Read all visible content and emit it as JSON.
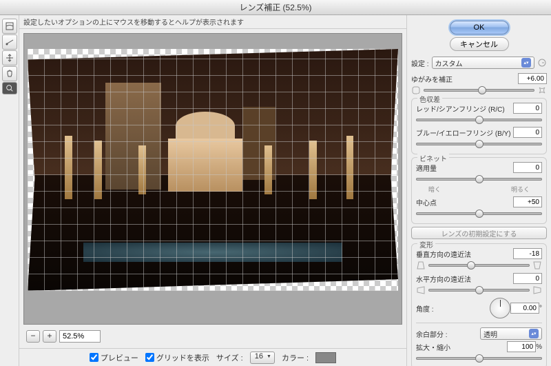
{
  "title": "レンズ補正 (52.5%)",
  "hint": "設定したいオプションの上にマウスを移動するとヘルプが表示されます",
  "zoom": {
    "value": "52.5%"
  },
  "bottom": {
    "preview": "プレビュー",
    "grid": "グリッドを表示",
    "size_label": "サイズ :",
    "size_value": "16",
    "color_label": "カラー :"
  },
  "buttons": {
    "ok": "OK",
    "cancel": "キャンセル"
  },
  "settings": {
    "label": "設定 :",
    "value": "カスタム"
  },
  "distortion": {
    "label": "ゆがみを補正",
    "value": "+6.00"
  },
  "chroma": {
    "title": "色収差",
    "rc_label": "レッド/シアンフリンジ (R/C)",
    "rc_value": "0",
    "by_label": "ブルー/イエローフリンジ (B/Y)",
    "by_value": "0"
  },
  "vignette": {
    "title": "ビネット",
    "amount_label": "適用量",
    "amount_value": "0",
    "dark": "暗く",
    "light": "明るく",
    "mid_label": "中心点",
    "mid_value": "+50"
  },
  "defaults_btn": "レンズの初期設定にする",
  "transform": {
    "title": "変形",
    "vpersp_label": "垂直方向の遠近法",
    "vpersp_value": "-18",
    "hpersp_label": "水平方向の遠近法",
    "hpersp_value": "0",
    "angle_label": "角度 :",
    "angle_value": "0.00",
    "edge_label": "余白部分 :",
    "edge_value": "透明",
    "scale_label": "拡大・縮小",
    "scale_value": "100",
    "pct": "%",
    "deg": "°"
  }
}
